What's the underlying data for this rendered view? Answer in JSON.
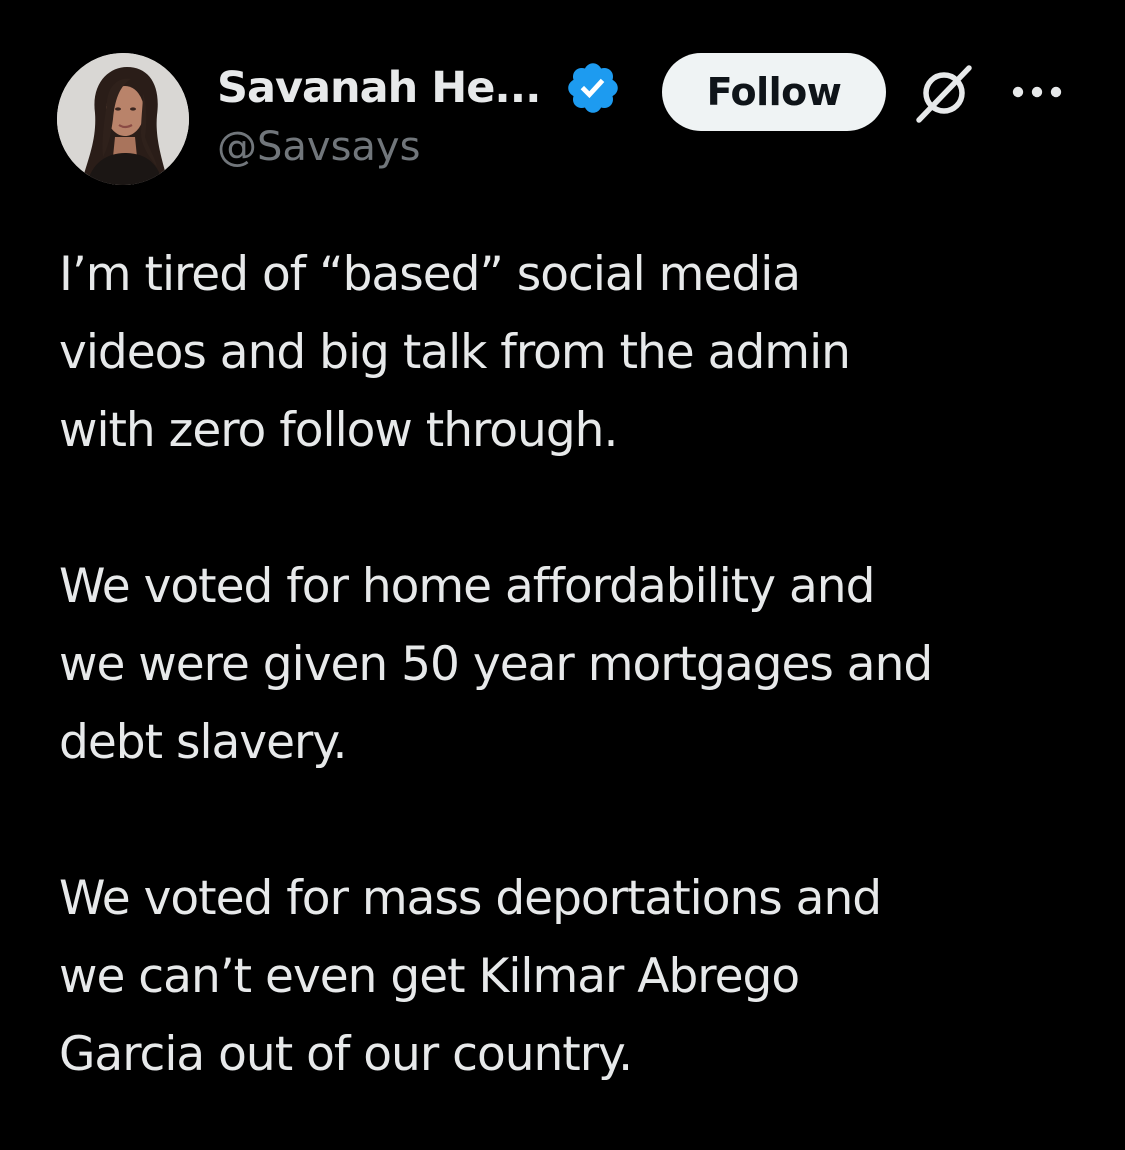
{
  "author": {
    "display_name": "Savanah He...",
    "handle": "@Savsays",
    "verified": true,
    "avatar_icon": "profile-photo"
  },
  "actions": {
    "follow_label": "Follow",
    "grok_icon": "grok-icon",
    "more_icon": "more-options-icon"
  },
  "tweet": {
    "paragraphs": [
      "I’m tired of “based” social media\nvideos and big talk from the admin\nwith zero follow through.",
      "We voted for home affordability and\nwe were given 50 year mortgages and\ndebt slavery.",
      "We voted for mass deportations and\nwe can’t even get Kilmar Abrego\nGarcia out of our country."
    ]
  },
  "colors": {
    "background": "#000000",
    "text_primary": "#e7e9ea",
    "text_secondary": "#71767b",
    "verified_blue": "#1d9bf0",
    "follow_bg": "#eff3f4",
    "follow_text": "#0f1419"
  }
}
